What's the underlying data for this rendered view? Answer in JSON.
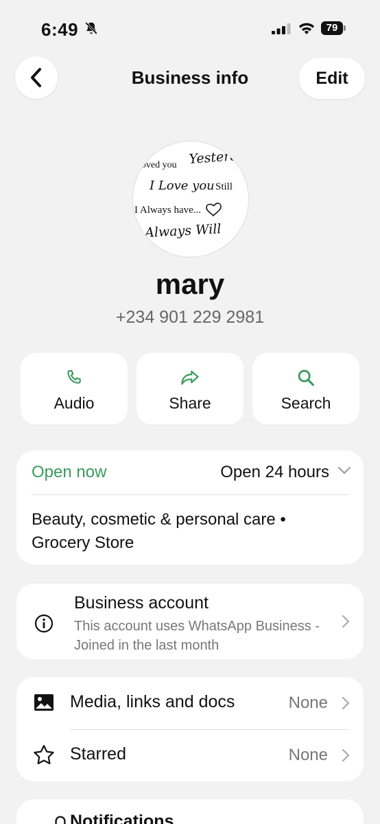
{
  "status_bar": {
    "time": "6:49",
    "battery": "79"
  },
  "nav": {
    "title": "Business info",
    "edit_label": "Edit"
  },
  "profile": {
    "avatar_text": [
      "loved you",
      "Yesterday",
      "I Love you",
      "Still",
      "I Always have...",
      "I Always Will"
    ],
    "name": "mary",
    "phone": "+234 901 229 2981"
  },
  "actions": [
    {
      "label": "Audio",
      "icon": "phone-icon"
    },
    {
      "label": "Share",
      "icon": "share-icon"
    },
    {
      "label": "Search",
      "icon": "search-icon"
    }
  ],
  "hours": {
    "status": "Open now",
    "value": "Open 24 hours",
    "category": "Beauty, cosmetic & personal care • Grocery Store"
  },
  "business_account": {
    "title": "Business account",
    "subtitle": "This account uses WhatsApp Business - Joined in the last month"
  },
  "rows": [
    {
      "label": "Media, links and docs",
      "value": "None",
      "icon": "image-icon"
    },
    {
      "label": "Starred",
      "value": "None",
      "icon": "star-icon"
    }
  ],
  "partial": {
    "label": "Notifications"
  },
  "colors": {
    "accent": "#3a9a5c",
    "background": "#f2f2f2"
  }
}
